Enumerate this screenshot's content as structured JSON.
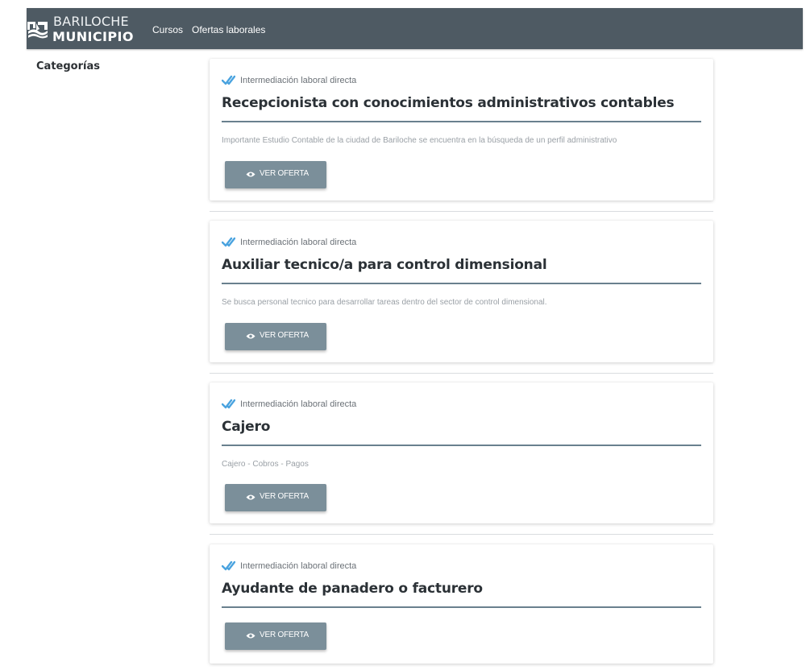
{
  "header": {
    "logo_top": "BARILOCHE",
    "logo_bottom": "MUNICIPIO",
    "nav": [
      {
        "label": "Cursos"
      },
      {
        "label": "Ofertas laborales"
      }
    ],
    "color": "#4e5a63"
  },
  "sidebar": {
    "title": "Categorías"
  },
  "cards": [
    {
      "category": "Intermediación laboral directa",
      "title": "Recepcionista con conocimientos administrativos contables",
      "description": "Importante Estudio Contable de la ciudad de Bariloche se encuentra en la búsqueda de un perfil administrativo",
      "button": "VER OFERTA"
    },
    {
      "category": "Intermediación laboral directa",
      "title": "Auxiliar tecnico/a para control dimensional",
      "description": "Se busca personal tecnico para desarrollar tareas dentro del sector de control dimensional.",
      "button": "VER OFERTA"
    },
    {
      "category": "Intermediación laboral directa",
      "title": "Cajero",
      "description": "Cajero - Cobros - Pagos",
      "button": "VER OFERTA"
    },
    {
      "category": "Intermediación laboral directa",
      "title": "Ayudante de panadero o facturero",
      "description": "",
      "button": "VER OFERTA"
    }
  ],
  "colors": {
    "accent_check": "#4aa3df",
    "button": "#7b8f9a",
    "rule": "#69808e"
  }
}
